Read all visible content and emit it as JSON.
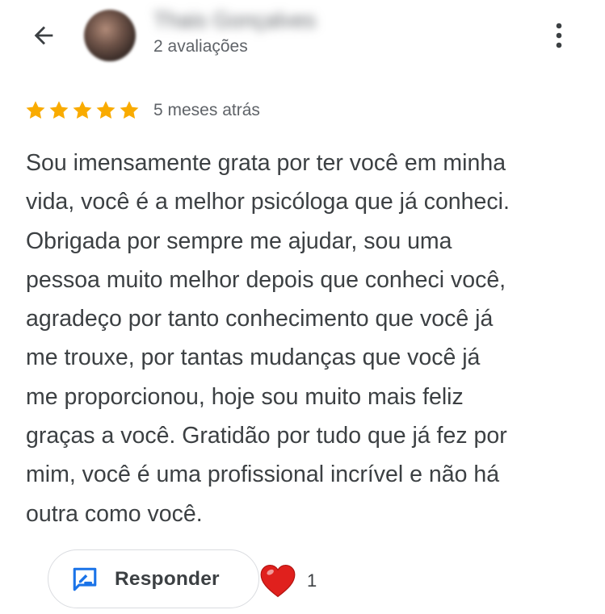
{
  "header": {
    "back_icon": "arrow-left-icon",
    "reviewer_name": "Thais Gonçalves",
    "review_count": "2 avaliações",
    "menu_icon": "more-vert-icon"
  },
  "review": {
    "rating": 5,
    "rating_max": 5,
    "star_color": "#f9ab00",
    "time_ago": "5 meses atrás",
    "text": "Sou imensamente grata por ter você em minha\nvida, você é a melhor psicóloga que já conheci.\nObrigada por sempre me ajudar, sou uma\npessoa muito melhor depois que conheci você,\nagradeço por tanto conhecimento que você já\nme trouxe, por tantas mudanças que você já\nme proporcionou, hoje sou muito mais feliz\ngraças a você. Gratidão por tudo que já fez por\nmim, você é uma profissional incrível e não há\noutra como você."
  },
  "actions": {
    "reply_label": "Responder",
    "reply_icon": "reply-edit-icon",
    "reply_icon_color": "#1a73e8",
    "reaction_icon": "heart-icon",
    "reaction_color": "#e0201d",
    "reaction_count": "1"
  }
}
